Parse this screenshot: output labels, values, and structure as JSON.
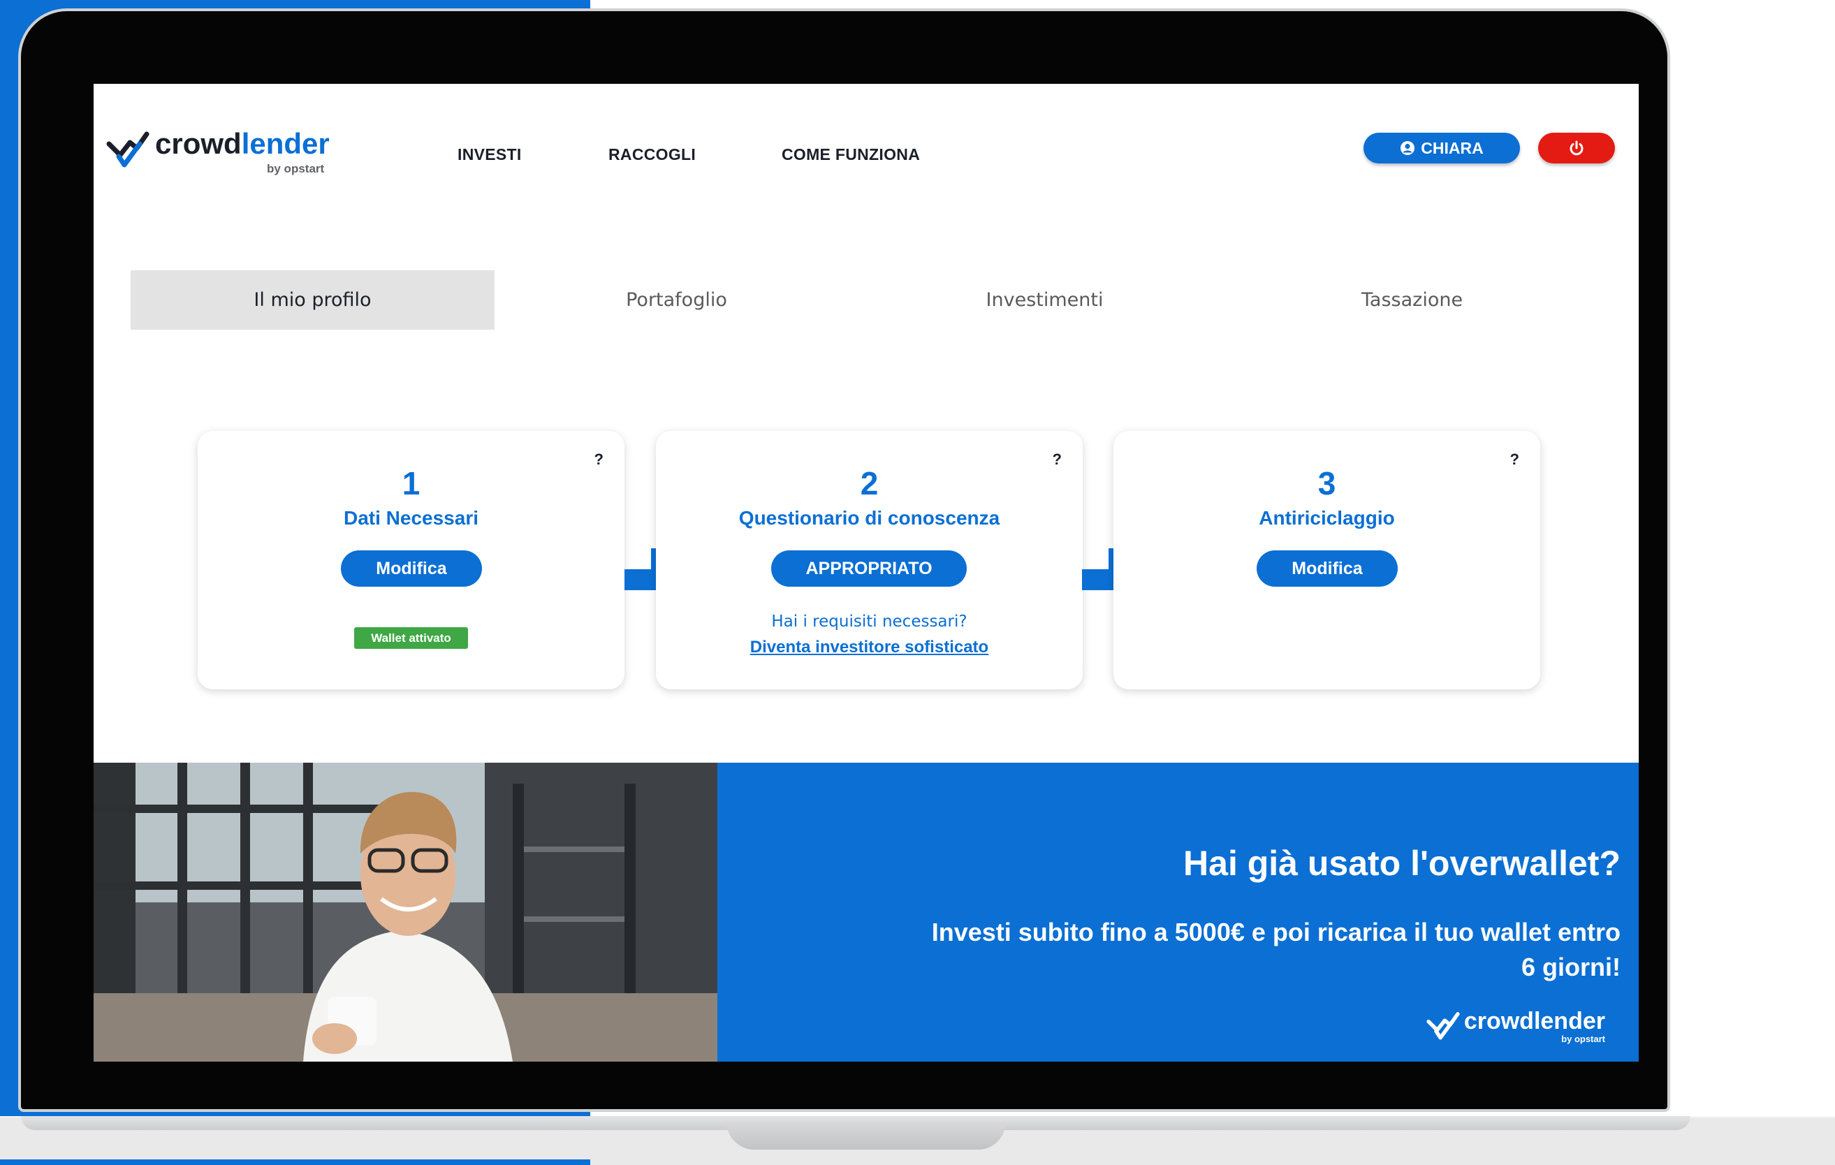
{
  "brand": {
    "logo_main_1": "crowd",
    "logo_main_2": "lender",
    "logo_sub": "by opstart",
    "primary_color": "#0b6fd4",
    "danger_color": "#e41b13",
    "success_color": "#3fa845"
  },
  "nav": {
    "items": [
      "INVESTI",
      "RACCOGLI",
      "COME FUNZIONA"
    ],
    "user_label": "CHIARA",
    "user_icon": "user-circle-icon",
    "logout_icon": "power-icon"
  },
  "tabs": [
    {
      "label": "Il mio profilo",
      "active": true
    },
    {
      "label": "Portafoglio",
      "active": false
    },
    {
      "label": "Investimenti",
      "active": false
    },
    {
      "label": "Tassazione",
      "active": false
    }
  ],
  "steps": [
    {
      "number": "1",
      "title": "Dati Necessari",
      "button": "Modifica",
      "help": "?",
      "badge": "Wallet attivato"
    },
    {
      "number": "2",
      "title": "Questionario di conoscenza",
      "button": "APPROPRIATO",
      "help": "?",
      "hint": "Hai i requisiti necessari?",
      "link": "Diventa investitore sofisticato"
    },
    {
      "number": "3",
      "title": "Antiriciclaggio",
      "button": "Modifica",
      "help": "?"
    }
  ],
  "banner": {
    "title": "Hai già usato l'overwallet?",
    "text": "Investi subito fino a 5000€ e poi ricarica il tuo wallet entro 6 giorni!",
    "logo_text": "crowdlender",
    "logo_sub": "by opstart"
  }
}
